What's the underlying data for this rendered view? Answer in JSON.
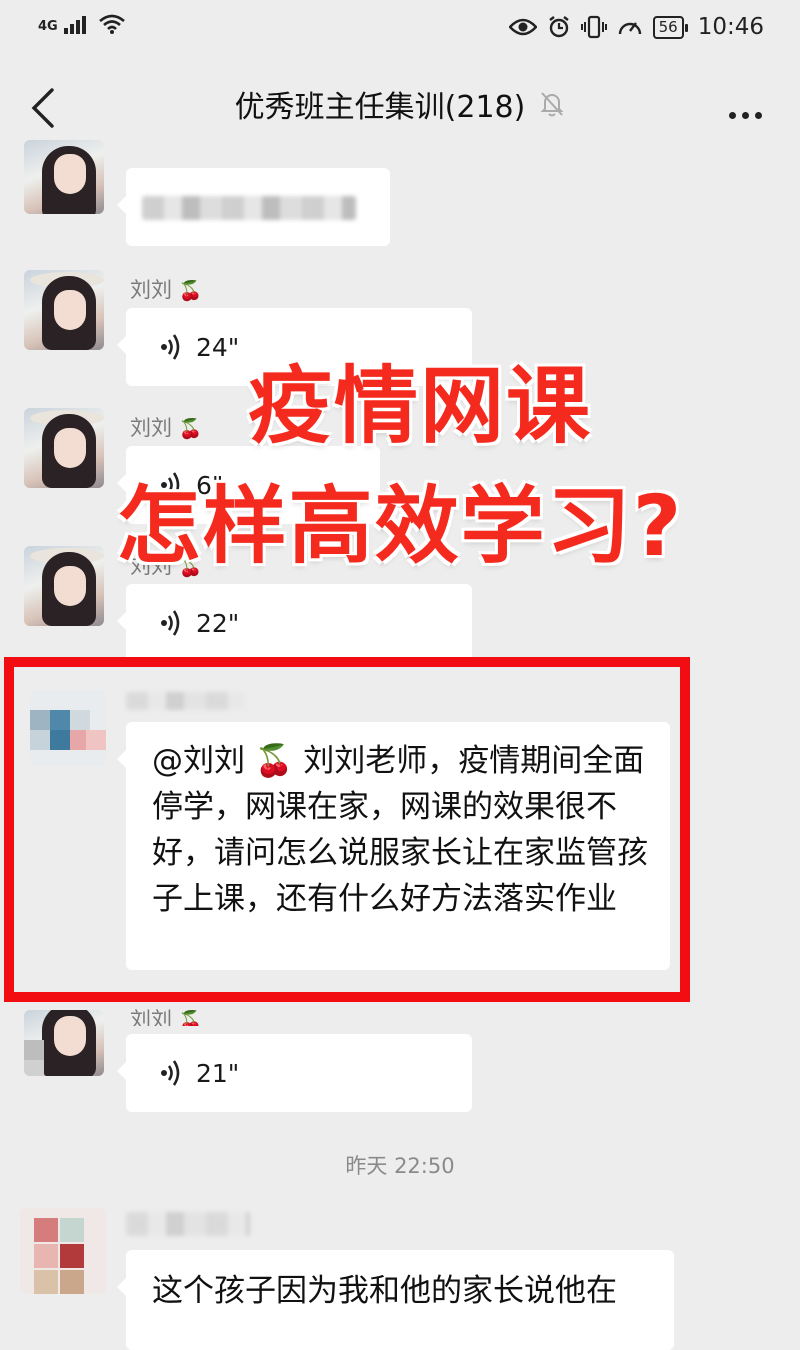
{
  "status_bar": {
    "network": "4G",
    "battery": "56",
    "time": "10:46"
  },
  "header": {
    "title": "优秀班主任集训(218)"
  },
  "messages": [
    {
      "sender": "刘刘",
      "emoji": "🍒",
      "duration": "24\""
    },
    {
      "sender": "刘刘",
      "emoji": "🍒",
      "duration": "6\""
    },
    {
      "sender": "刘刘",
      "emoji": "🍒",
      "duration": "22\""
    },
    {
      "text": "@刘刘 🍒 刘刘老师，疫情期间全面停学，网课在家，网课的效果很不好，请问怎么说服家长让在家监管孩子上课，还有什么好方法落实作业"
    },
    {
      "sender": "刘刘",
      "emoji": "🍒",
      "duration": "21\""
    },
    {
      "text": "这个孩子因为我和他的家长说他在"
    }
  ],
  "timestamp": "昨天 22:50",
  "overlay": {
    "line1": "疫情网课",
    "line2": "怎样高效学习?"
  },
  "colors": {
    "highlight_border": "#f20d12",
    "overlay_text": "#f52a1e",
    "chat_background": "#ededed"
  }
}
